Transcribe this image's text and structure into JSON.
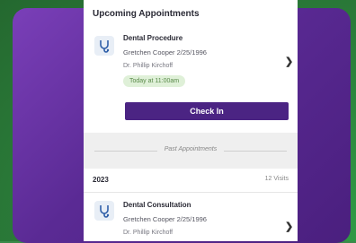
{
  "upcoming": {
    "section_title": "Upcoming Appointments",
    "appointment": {
      "title": "Dental Procedure",
      "patient": "Gretchen Cooper 2/25/1996",
      "doctor": "Dr. Phillip Kirchoff",
      "time_badge": "Today at 11:00am",
      "checkin_label": "Check In"
    }
  },
  "past": {
    "divider_label": "Past Appointments",
    "year": "2023",
    "visits": "12 Visits",
    "appointment": {
      "title": "Dental Consultation",
      "patient": "Gretchen Cooper 2/25/1996",
      "doctor": "Dr. Phillip Kirchoff"
    }
  },
  "icons": {
    "appointment_icon": "stethoscope-icon",
    "row_chevron": "chevron-right-icon"
  },
  "colors": {
    "primary": "#4b2483",
    "badge_bg": "#dff0d8",
    "badge_text": "#5a8a4a"
  }
}
